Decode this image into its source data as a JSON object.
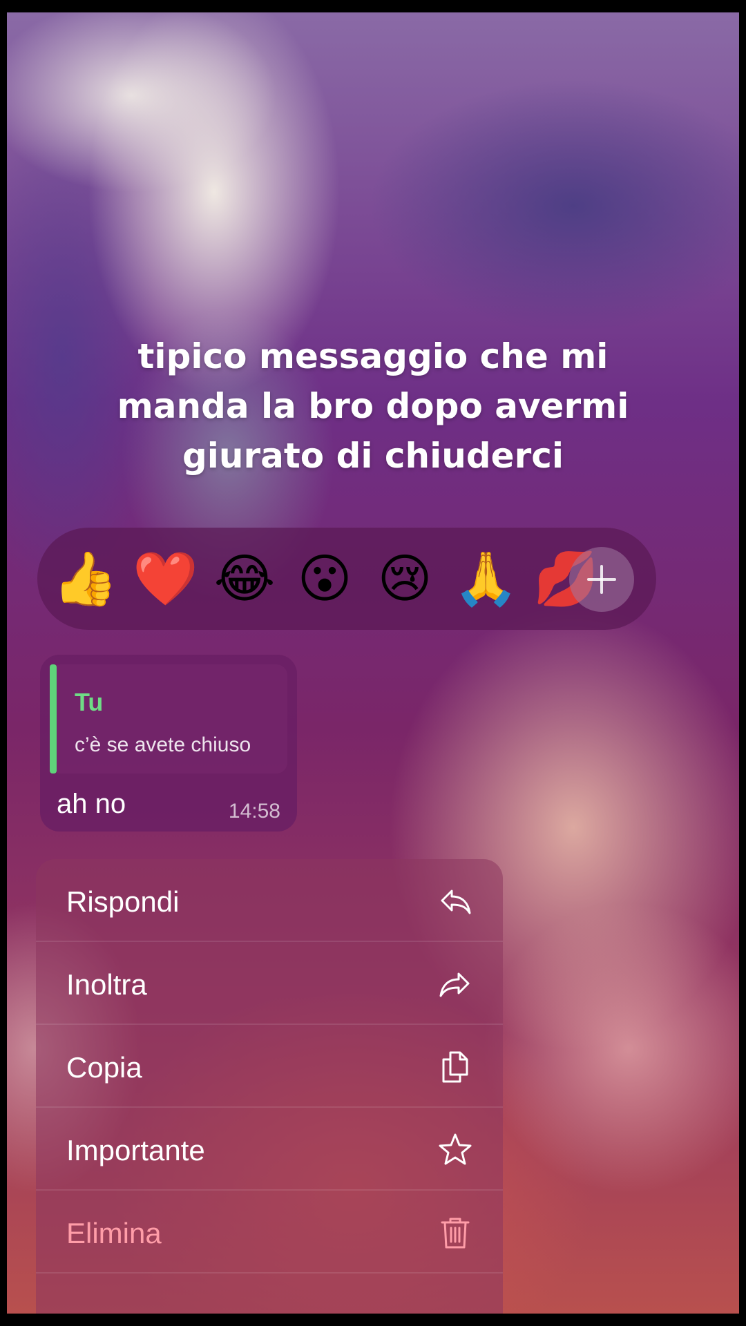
{
  "caption": {
    "line1": "tipico messaggio che mi",
    "line2": "manda la bro dopo avermi",
    "line3": "giurato di chiuderci"
  },
  "reactions": {
    "items": [
      {
        "emoji": "👍",
        "icon": "thumbs-up-icon"
      },
      {
        "emoji": "❤️",
        "icon": "heart-icon"
      },
      {
        "emoji": "😂",
        "icon": "tears-of-joy-icon"
      },
      {
        "emoji": "😮",
        "icon": "surprised-face-icon"
      },
      {
        "emoji": "😢",
        "icon": "crying-face-icon"
      },
      {
        "emoji": "🙏",
        "icon": "folded-hands-icon"
      },
      {
        "emoji": "💋",
        "icon": "kiss-mark-icon"
      }
    ],
    "more_icon": "plus-icon"
  },
  "message": {
    "quote_author": "Tu",
    "quote_text": "c’è se avete chiuso",
    "text": "ah no",
    "time": "14:58"
  },
  "menu": {
    "items": [
      {
        "label": "Rispondi",
        "icon": "reply-icon"
      },
      {
        "label": "Inoltra",
        "icon": "forward-icon"
      },
      {
        "label": "Copia",
        "icon": "copy-icon"
      },
      {
        "label": "Importante",
        "icon": "star-icon"
      },
      {
        "label": "Elimina",
        "icon": "trash-icon",
        "color": "#ff9da8"
      }
    ]
  }
}
